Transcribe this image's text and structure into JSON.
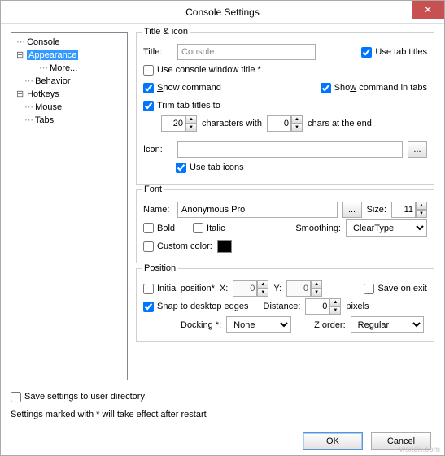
{
  "window": {
    "title": "Console Settings"
  },
  "tree": {
    "items": [
      {
        "label": "Console",
        "indent": 0,
        "toggle": ""
      },
      {
        "label": "Appearance",
        "indent": 0,
        "toggle": "⊟",
        "selected": true
      },
      {
        "label": "More...",
        "indent": 2,
        "toggle": ""
      },
      {
        "label": "Behavior",
        "indent": 1,
        "toggle": ""
      },
      {
        "label": "Hotkeys",
        "indent": 0,
        "toggle": "⊟"
      },
      {
        "label": "Mouse",
        "indent": 1,
        "toggle": ""
      },
      {
        "label": "Tabs",
        "indent": 1,
        "toggle": ""
      }
    ]
  },
  "title_icon": {
    "legend": "Title & icon",
    "title_label": "Title:",
    "title_value": "Console",
    "use_tab_titles": "Use tab titles",
    "use_tab_titles_checked": true,
    "use_console_window_title": "Use console window title *",
    "use_console_window_title_checked": false,
    "show_command": "Show command",
    "show_command_checked": true,
    "show_command_in_tabs": "Show command in tabs",
    "show_command_in_tabs_checked": true,
    "trim_tab_titles": "Trim tab titles to",
    "trim_tab_titles_checked": true,
    "trim_chars": "20",
    "chars_with": "characters with",
    "end_chars": "0",
    "chars_at_end": "chars at the end",
    "icon_label": "Icon:",
    "icon_value": "",
    "browse": "...",
    "use_tab_icons": "Use tab icons",
    "use_tab_icons_checked": true
  },
  "font": {
    "legend": "Font",
    "name_label": "Name:",
    "name_value": "Anonymous Pro",
    "browse": "...",
    "size_label": "Size:",
    "size_value": "11",
    "bold": "Bold",
    "bold_checked": false,
    "italic": "Italic",
    "italic_checked": false,
    "smoothing_label": "Smoothing:",
    "smoothing_value": "ClearType",
    "custom_color": "Custom color:",
    "custom_color_checked": false,
    "custom_color_value": "#000000"
  },
  "position": {
    "legend": "Position",
    "initial_position": "Initial position*",
    "initial_position_checked": false,
    "x_label": "X:",
    "x_value": "0",
    "y_label": "Y:",
    "y_value": "0",
    "save_on_exit": "Save on exit",
    "save_on_exit_checked": false,
    "snap": "Snap to desktop edges",
    "snap_checked": true,
    "distance_label": "Distance:",
    "distance_value": "0",
    "pixels": "pixels",
    "docking_label": "Docking *:",
    "docking_value": "None",
    "zorder_label": "Z order:",
    "zorder_value": "Regular"
  },
  "footer": {
    "save_settings": "Save settings to user directory",
    "save_settings_checked": false,
    "restart_note": "Settings marked with * will take effect after restart",
    "ok": "OK",
    "cancel": "Cancel"
  },
  "watermark": "wsxdn.com"
}
